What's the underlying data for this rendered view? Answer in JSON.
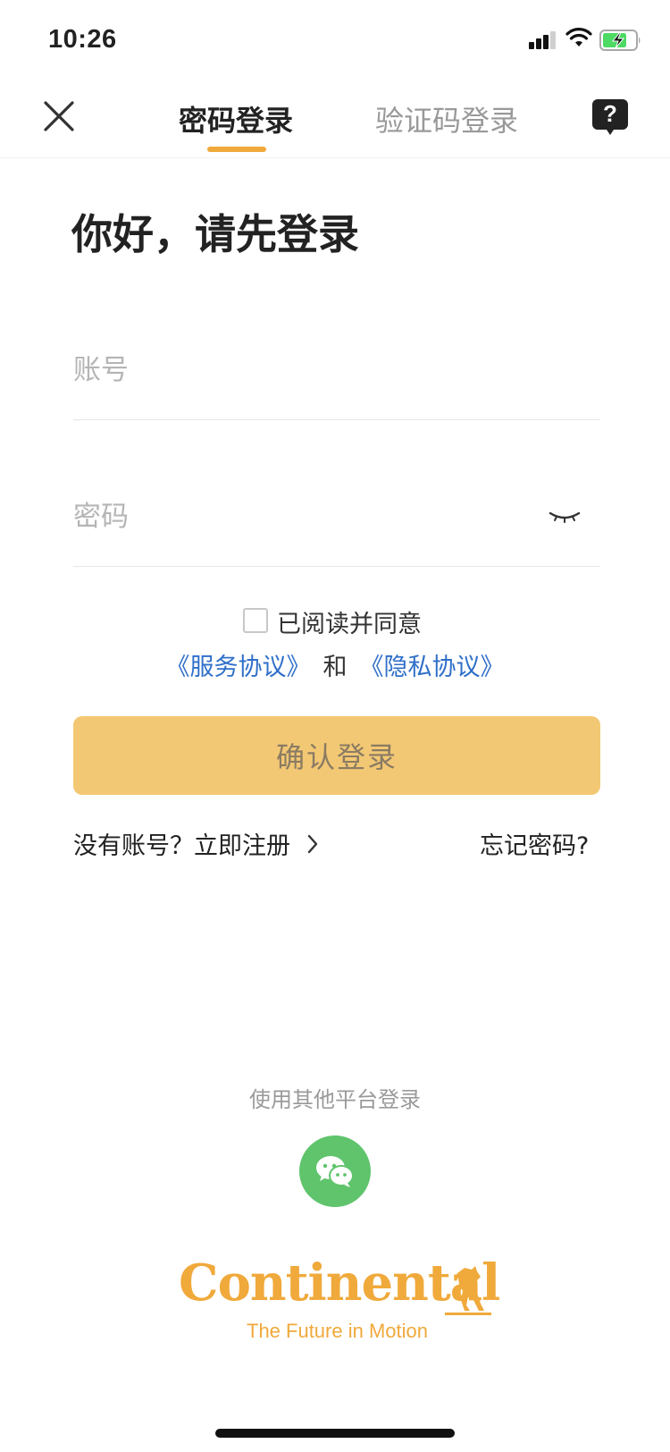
{
  "status_bar": {
    "time": "10:26",
    "icons": [
      "cellular-signal-icon",
      "wifi-icon",
      "battery-charging-icon"
    ],
    "battery_color": "#4cd964"
  },
  "nav": {
    "tabs": [
      {
        "label": "密码登录",
        "active": true
      },
      {
        "label": "验证码登录",
        "active": false
      }
    ],
    "close_icon": "close-icon",
    "help_icon": "help-icon",
    "help_symbol": "?"
  },
  "greeting": "你好，请先登录",
  "form": {
    "account_placeholder": "账号",
    "account_value": "",
    "password_placeholder": "密码",
    "password_value": "",
    "eye_icon": "eye-closed-icon"
  },
  "agreement": {
    "checked": false,
    "text": "已阅读并同意",
    "service_link": "《服务协议》",
    "and_text": "和",
    "privacy_link": "《隐私协议》"
  },
  "login_button": {
    "label": "确认登录",
    "color": "#f3c874"
  },
  "links": {
    "register": "没有账号？立即注册",
    "forgot": "忘记密码?"
  },
  "other_login": {
    "label": "使用其他平台登录",
    "platforms": [
      {
        "name": "wechat",
        "icon": "wechat-icon",
        "color": "#5fc46c"
      }
    ]
  },
  "brand": {
    "name": "Continental",
    "tagline": "The Future in Motion",
    "color": "#f0a93b"
  },
  "colors": {
    "accent": "#f0a93b",
    "link": "#2f6fc9"
  }
}
